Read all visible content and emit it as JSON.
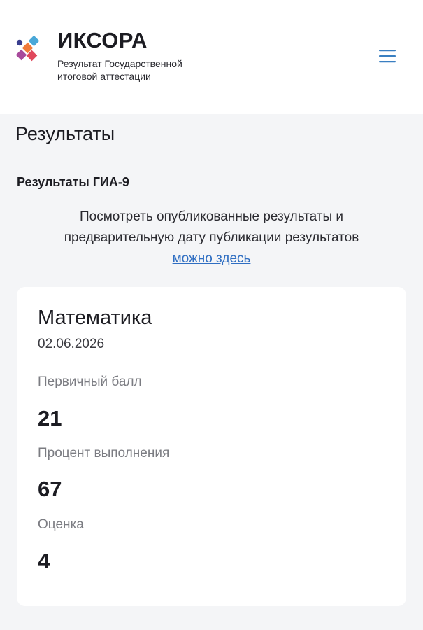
{
  "header": {
    "brand_name": "ИКСОРА",
    "brand_subtitle": "Результат Государственной итоговой аттестации",
    "logo_colors": [
      "#3a3f8f",
      "#4aa8d8",
      "#f07a3a",
      "#a84a9c",
      "#e0485c"
    ],
    "menu_icon": "hamburger-menu-icon"
  },
  "page": {
    "title": "Результаты"
  },
  "section": {
    "title": "Результаты ГИА-9",
    "info_text": "Посмотреть опубликованные результаты и предварительную дату публикации результатов",
    "info_link": "можно здесь"
  },
  "result": {
    "subject": "Математика",
    "date": "02.06.2026",
    "fields": [
      {
        "label": "Первичный балл",
        "value": "21"
      },
      {
        "label": "Процент выполнения",
        "value": "67"
      },
      {
        "label": "Оценка",
        "value": "4"
      }
    ]
  },
  "colors": {
    "accent_link": "#2f6ec2",
    "menu_icon": "#3a7fc1",
    "page_background": "#f4f5f7"
  }
}
